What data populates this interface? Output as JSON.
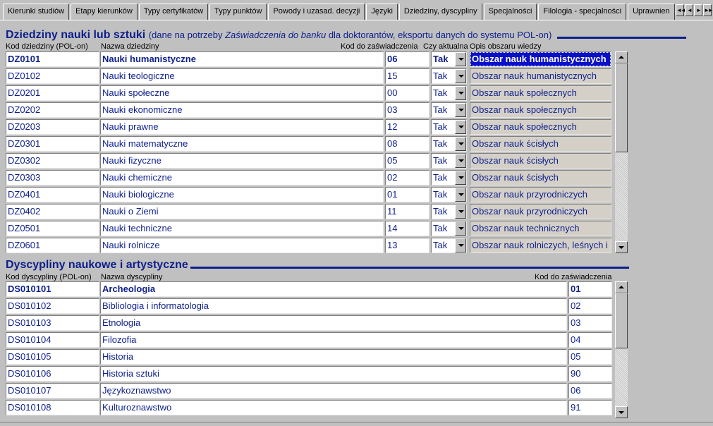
{
  "tabs": [
    {
      "label": "Kierunki studiów"
    },
    {
      "label": "Etapy kierunków"
    },
    {
      "label": "Typy certyfikatów"
    },
    {
      "label": "Typy punktów"
    },
    {
      "label": "Powody i uzasad. decyzji"
    },
    {
      "label": "Języki"
    },
    {
      "label": "Dziedziny, dyscypliny",
      "active": true
    },
    {
      "label": "Specjalności"
    },
    {
      "label": "Filologia - specjalności"
    },
    {
      "label": "Uprawnien"
    }
  ],
  "tab_nav": [
    "◄◄",
    "◄",
    "►",
    "►►"
  ],
  "dziedziny": {
    "title": "Dziedziny nauki lub sztuki",
    "subtitle_prefix": "(dane na potrzeby ",
    "subtitle_italic": "Zaświadczenia do banku",
    "subtitle_suffix": " dla doktorantów, eksportu danych do systemu POL-on)",
    "headers": {
      "kod": "Kod dziedziny (POL-on)",
      "nazwa": "Nazwa dziedziny",
      "kod_zasw": "Kod do zaświadczenia",
      "aktualna": "Czy aktualna",
      "opis": "Opis obszaru wiedzy"
    },
    "rows": [
      {
        "kod": "DZ0101",
        "nazwa": "Nauki humanistyczne",
        "kod_zasw": "06",
        "aktualna": "Tak",
        "opis": "Obszar nauk humanistycznych",
        "selected": true
      },
      {
        "kod": "DZ0102",
        "nazwa": "Nauki teologiczne",
        "kod_zasw": "15",
        "aktualna": "Tak",
        "opis": "Obszar nauk humanistycznych"
      },
      {
        "kod": "DZ0201",
        "nazwa": "Nauki społeczne",
        "kod_zasw": "00",
        "aktualna": "Tak",
        "opis": "Obszar nauk społecznych"
      },
      {
        "kod": "DZ0202",
        "nazwa": "Nauki ekonomiczne",
        "kod_zasw": "03",
        "aktualna": "Tak",
        "opis": "Obszar nauk społecznych"
      },
      {
        "kod": "DZ0203",
        "nazwa": "Nauki prawne",
        "kod_zasw": "12",
        "aktualna": "Tak",
        "opis": "Obszar nauk społecznych"
      },
      {
        "kod": "DZ0301",
        "nazwa": "Nauki matematyczne",
        "kod_zasw": "08",
        "aktualna": "Tak",
        "opis": "Obszar nauk ścisłych"
      },
      {
        "kod": "DZ0302",
        "nazwa": "Nauki fizyczne",
        "kod_zasw": "05",
        "aktualna": "Tak",
        "opis": "Obszar nauk ścisłych"
      },
      {
        "kod": "DZ0303",
        "nazwa": "Nauki chemiczne",
        "kod_zasw": "02",
        "aktualna": "Tak",
        "opis": "Obszar nauk ścisłych"
      },
      {
        "kod": "DZ0401",
        "nazwa": "Nauki biologiczne",
        "kod_zasw": "01",
        "aktualna": "Tak",
        "opis": "Obszar nauk przyrodniczych"
      },
      {
        "kod": "DZ0402",
        "nazwa": "Nauki o Ziemi",
        "kod_zasw": "11",
        "aktualna": "Tak",
        "opis": "Obszar nauk przyrodniczych"
      },
      {
        "kod": "DZ0501",
        "nazwa": "Nauki techniczne",
        "kod_zasw": "14",
        "aktualna": "Tak",
        "opis": "Obszar nauk technicznych"
      },
      {
        "kod": "DZ0601",
        "nazwa": "Nauki rolnicze",
        "kod_zasw": "13",
        "aktualna": "Tak",
        "opis": "Obszar nauk rolniczych, leśnych i"
      }
    ]
  },
  "dyscypliny": {
    "title": "Dyscypliny naukowe i artystyczne",
    "headers": {
      "kod": "Kod dyscypliny (POL-on)",
      "nazwa": "Nazwa dyscypliny",
      "kod_zasw": "Kod do zaświadczenia"
    },
    "rows": [
      {
        "kod": "DS010101",
        "nazwa": "Archeologia",
        "kod_zasw": "01",
        "selected": true
      },
      {
        "kod": "DS010102",
        "nazwa": "Bibliologia i informatologia",
        "kod_zasw": "02"
      },
      {
        "kod": "DS010103",
        "nazwa": "Etnologia",
        "kod_zasw": "03"
      },
      {
        "kod": "DS010104",
        "nazwa": "Filozofia",
        "kod_zasw": "04"
      },
      {
        "kod": "DS010105",
        "nazwa": "Historia",
        "kod_zasw": "05"
      },
      {
        "kod": "DS010106",
        "nazwa": "Historia sztuki",
        "kod_zasw": "90"
      },
      {
        "kod": "DS010107",
        "nazwa": "Językoznawstwo",
        "kod_zasw": "06"
      },
      {
        "kod": "DS010108",
        "nazwa": "Kulturoznawstwo",
        "kod_zasw": "91"
      }
    ]
  },
  "colors": {
    "title": "#0d1f8c",
    "selection": "#0a10c8",
    "background": "#c0c0c0"
  }
}
